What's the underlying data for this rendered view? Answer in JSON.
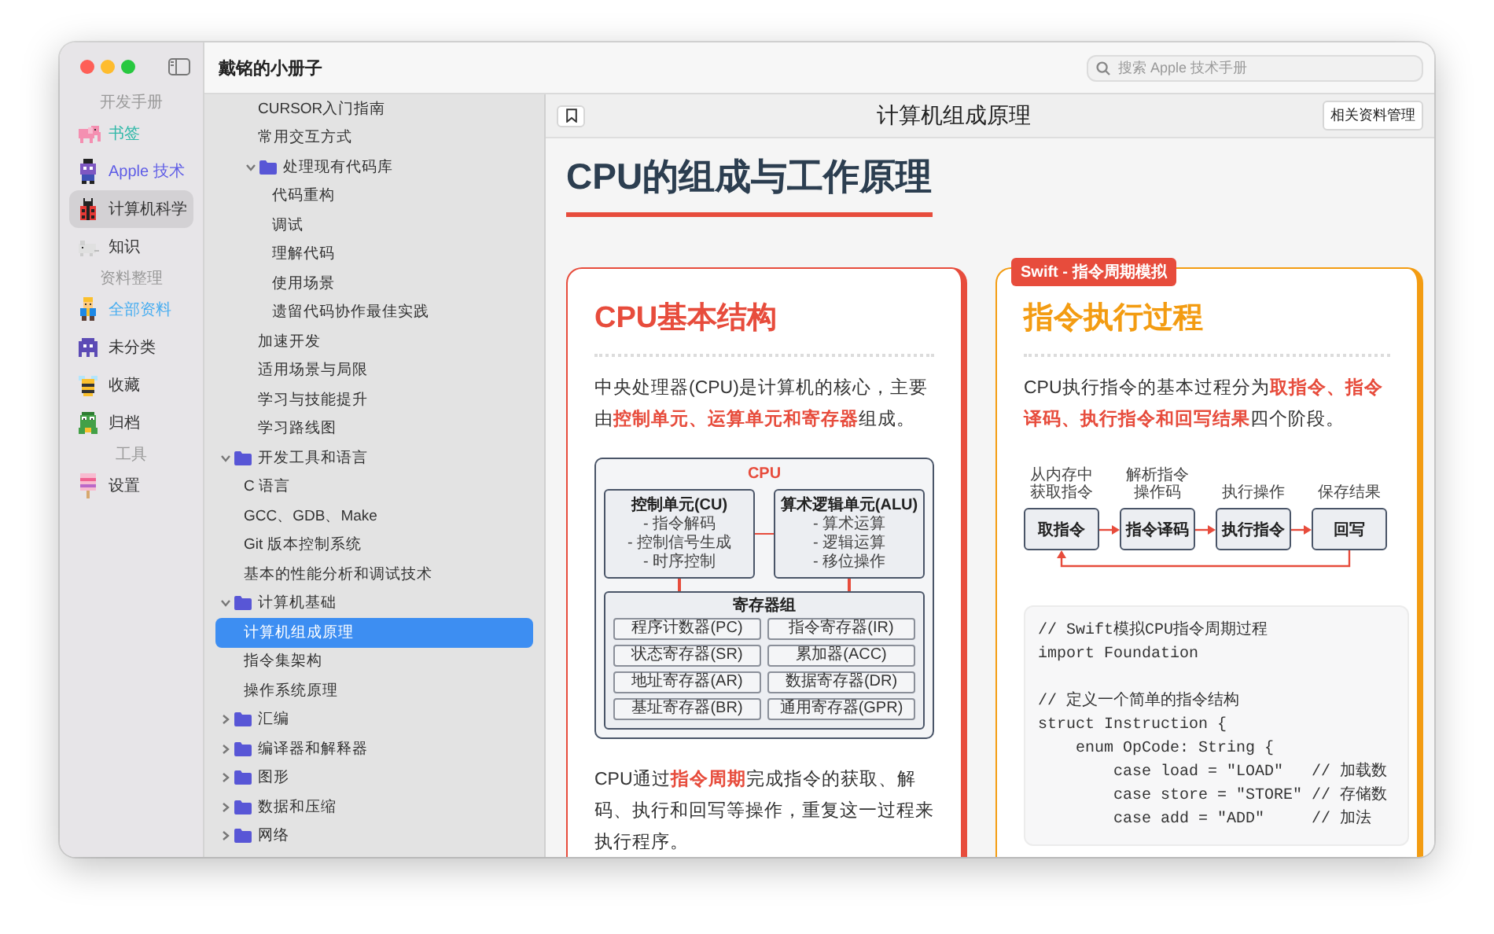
{
  "window": {
    "title": "戴铭的小册子"
  },
  "search": {
    "placeholder": "搜索 Apple 技术手册"
  },
  "sidebar": {
    "sections": [
      {
        "heading": "开发手册",
        "items": [
          {
            "label": "书签",
            "kind": "elephant",
            "color": "#2fb8a8",
            "selected": false
          },
          {
            "label": "Apple 技术",
            "kind": "robot",
            "color": "#5e5ce6",
            "selected": false
          },
          {
            "label": "计算机科学",
            "kind": "ladybug",
            "color": "#333333",
            "selected": true
          },
          {
            "label": "知识",
            "kind": "mouse",
            "color": "#333333",
            "selected": false
          }
        ]
      },
      {
        "heading": "资料整理",
        "items": [
          {
            "label": "全部资料",
            "kind": "king",
            "color": "#4aaef0",
            "selected": false
          },
          {
            "label": "未分类",
            "kind": "invader",
            "color": "#333333",
            "selected": false
          },
          {
            "label": "收藏",
            "kind": "bee",
            "color": "#333333",
            "selected": false
          },
          {
            "label": "归档",
            "kind": "frog",
            "color": "#333333",
            "selected": false
          }
        ]
      },
      {
        "heading": "工具",
        "items": [
          {
            "label": "设置",
            "kind": "popsicle",
            "color": "#333333",
            "selected": false
          }
        ]
      }
    ]
  },
  "tree": [
    {
      "children": [
        {
          "children": [
            {
              "label": "CURSOR入门指南",
              "selected": false
            },
            {
              "label": "常用交互方式",
              "selected": false
            },
            {
              "label": "处理现有代码库",
              "selected": false,
              "expanded": true,
              "children": [
                {
                  "label": "代码重构",
                  "selected": false
                },
                {
                  "label": "调试",
                  "selected": false
                },
                {
                  "label": "理解代码",
                  "selected": false
                },
                {
                  "label": "使用场景",
                  "selected": false
                },
                {
                  "label": "遗留代码协作最佳实践",
                  "selected": false
                }
              ]
            },
            {
              "label": "加速开发",
              "selected": false
            },
            {
              "label": "适用场景与局限",
              "selected": false
            },
            {
              "label": "学习与技能提升",
              "selected": false
            },
            {
              "label": "学习路线图",
              "selected": false
            }
          ]
        }
      ]
    },
    {
      "label": "开发工具和语言",
      "selected": false,
      "expanded": true,
      "children": [
        {
          "label": "C 语言",
          "selected": false
        },
        {
          "label": "GCC、GDB、Make",
          "selected": false
        },
        {
          "label": "Git 版本控制系统",
          "selected": false
        },
        {
          "label": "基本的性能分析和调试技术",
          "selected": false
        }
      ]
    },
    {
      "label": "计算机基础",
      "selected": false,
      "expanded": true,
      "children": [
        {
          "label": "计算机组成原理",
          "selected": true
        },
        {
          "label": "指令集架构",
          "selected": false
        },
        {
          "label": "操作系统原理",
          "selected": false
        }
      ]
    },
    {
      "label": "汇编",
      "selected": false,
      "expanded": false
    },
    {
      "label": "编译器和解释器",
      "selected": false,
      "expanded": false
    },
    {
      "label": "图形",
      "selected": false,
      "expanded": false
    },
    {
      "label": "数据和压缩",
      "selected": false,
      "expanded": false
    },
    {
      "label": "网络",
      "selected": false,
      "expanded": false
    }
  ],
  "toolbar": {
    "title": "计算机组成原理",
    "button": "相关资料管理"
  },
  "article": {
    "heading": "CPU的组成与工作原理",
    "cards": [
      {
        "kind": "structure",
        "title": "CPU基本结构",
        "color": "#e74c3c",
        "intro": "中央处理器(CPU)是计算机的核心，主要由**控制单元、运算单元和寄存器**组成。",
        "diagram": {
          "title": "CPU",
          "units": [
            {
              "title": "控制单元(CU)",
              "lines": [
                "- 指令解码",
                "- 控制信号生成",
                "- 时序控制"
              ]
            },
            {
              "title": "算术逻辑单元(ALU)",
              "lines": [
                "- 算术运算",
                "- 逻辑运算",
                "- 移位操作"
              ]
            }
          ],
          "registers": {
            "title": "寄存器组",
            "items": [
              "程序计数器(PC)",
              "指令寄存器(IR)",
              "状态寄存器(SR)",
              "累加器(ACC)",
              "地址寄存器(AR)",
              "数据寄存器(DR)",
              "基址寄存器(BR)",
              "通用寄存器(GPR)"
            ]
          }
        },
        "outro": "CPU通过**指令周期**完成指令的获取、解码、执行和回写等操作，重复这一过程来执行程序。"
      },
      {
        "kind": "process",
        "badge": "Swift - 指令周期模拟",
        "title": "指令执行过程",
        "color": "#f39c12",
        "intro": "CPU执行指令的基本过程分为**取指令、指令译码、执行指令和回写结果**四个阶段。",
        "steps": [
          {
            "caption": "从内存中获取指令",
            "label": "取指令"
          },
          {
            "caption": "解析指令操作码",
            "label": "指令译码"
          },
          {
            "caption": "执行操作",
            "label": "执行指令"
          },
          {
            "caption": "保存结果",
            "label": "回写"
          }
        ],
        "code": "// Swift模拟CPU指令周期过程\nimport Foundation\n\n// 定义一个简单的指令结构\nstruct Instruction {\n    enum OpCode: String {\n        case load = \"LOAD\"   // 加载数\n        case store = \"STORE\" // 存储数\n        case add = \"ADD\"     // 加法"
      }
    ]
  }
}
